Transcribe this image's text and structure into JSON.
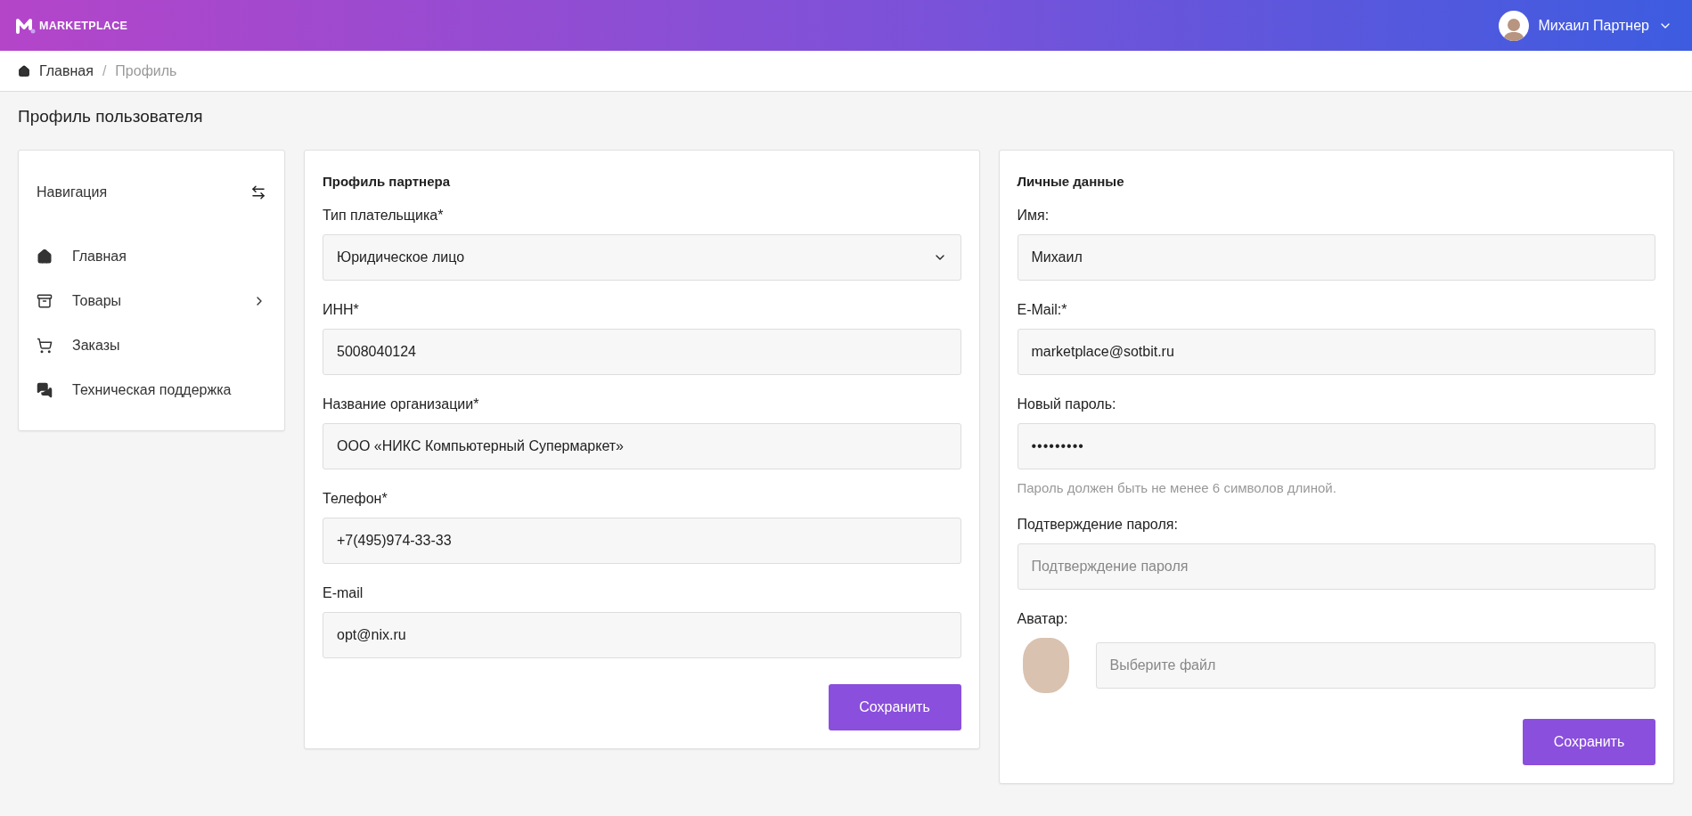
{
  "header": {
    "logo": "MARKETPLACE",
    "user": "Михаил Партнер"
  },
  "breadcrumbs": [
    {
      "label": "Главная",
      "current": false
    },
    {
      "label": "Профиль",
      "current": true
    }
  ],
  "breadcrumb_separator": "/",
  "page_title": "Профиль пользователя",
  "sidebar": {
    "title": "Навигация",
    "items": [
      {
        "label": "Главная",
        "has_children": false
      },
      {
        "label": "Товары",
        "has_children": true
      },
      {
        "label": "Заказы",
        "has_children": false
      },
      {
        "label": "Техническая поддержка",
        "has_children": false
      }
    ]
  },
  "partner_profile": {
    "title": "Профиль партнера",
    "fields": [
      {
        "kind": "select",
        "label": "Тип плательщика*",
        "value": "Юридическое лицо"
      },
      {
        "kind": "text",
        "label": "ИНН*",
        "value": "5008040124"
      },
      {
        "kind": "text",
        "label": "Название организации*",
        "value": "ООО «НИКС Компьютерный Супермаркет»"
      },
      {
        "kind": "text",
        "label": "Телефон*",
        "value": "+7(495)974-33-33"
      },
      {
        "kind": "text",
        "label": "E-mail",
        "value": "opt@nix.ru"
      }
    ],
    "button": "Сохранить"
  },
  "personal_data": {
    "title": "Личные данные",
    "fields": [
      {
        "kind": "text",
        "label": "Имя:",
        "value": "Михаил"
      },
      {
        "kind": "text",
        "label": "E-Mail:*",
        "value": "marketplace@sotbit.ru"
      },
      {
        "kind": "password",
        "label": "Новый пароль:",
        "value": "•••••••••",
        "hint": "Пароль должен быть не менее 6 символов длиной."
      },
      {
        "kind": "text",
        "label": "Подтверждение пароля:",
        "placeholder": "Подтверждение пароля"
      },
      {
        "kind": "file",
        "label": "Аватар:",
        "placeholder": "Выберите файл"
      }
    ],
    "button": "Сохранить"
  }
}
